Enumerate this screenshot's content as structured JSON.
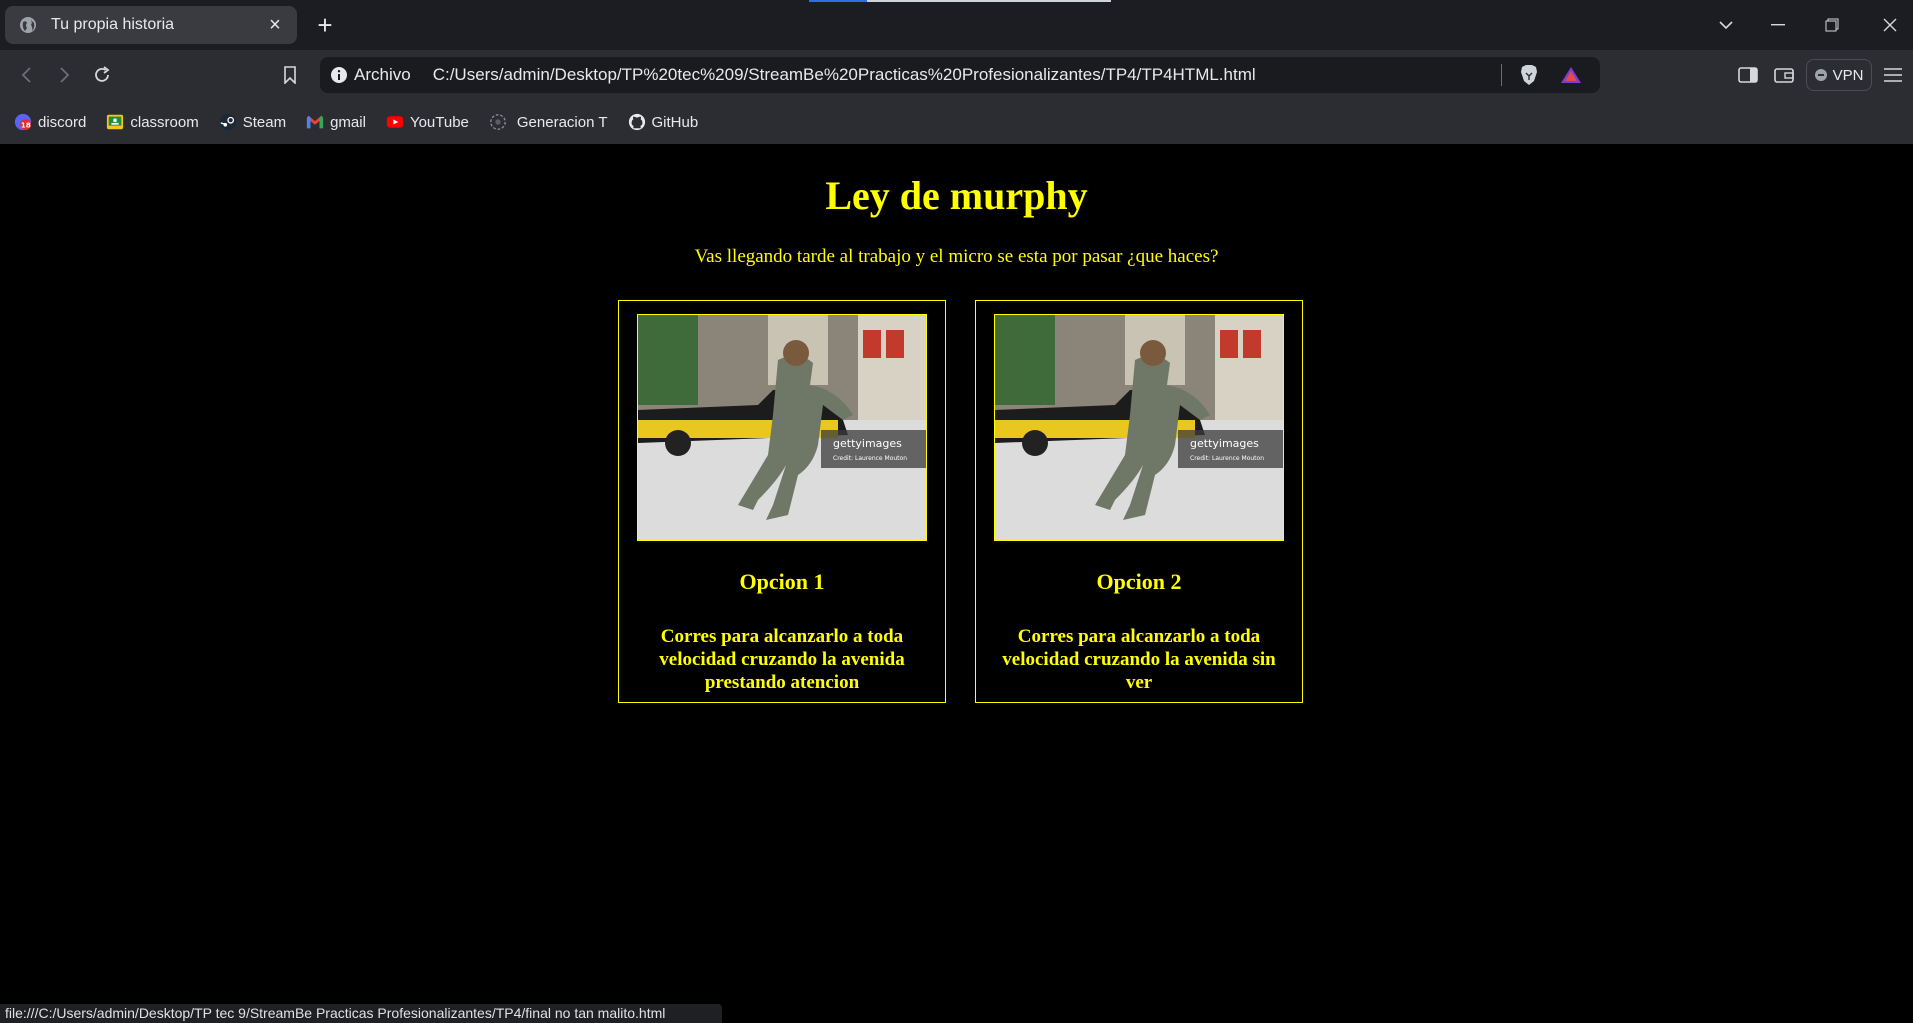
{
  "browser": {
    "tab": {
      "title": "Tu propia historia"
    },
    "address": {
      "scheme_label": "Archivo",
      "url": "C:/Users/admin/Desktop/TP%20tec%209/StreamBe%20Practicas%20Profesionalizantes/TP4/TP4HTML.html"
    },
    "vpn_label": "VPN",
    "bookmarks": [
      {
        "label": "discord",
        "icon": "discord-icon",
        "badge": "18"
      },
      {
        "label": "classroom",
        "icon": "classroom-icon"
      },
      {
        "label": "Steam",
        "icon": "steam-icon"
      },
      {
        "label": "gmail",
        "icon": "gmail-icon"
      },
      {
        "label": "YouTube",
        "icon": "youtube-icon"
      },
      {
        "label": "Generacion T",
        "icon": "generacion-t-icon"
      },
      {
        "label": "GitHub",
        "icon": "github-icon"
      }
    ],
    "status_url": "file:///C:/Users/admin/Desktop/TP tec 9/StreamBe Practicas Profesionalizantes/TP4/final no tan malito.html"
  },
  "page": {
    "title": "Ley de murphy",
    "prompt": "Vas llegando tarde al trabajo y el micro se esta por pasar ¿que haces?",
    "options": [
      {
        "label": "Opcion 1",
        "description": "Corres para alcanzarlo a toda velocidad cruzando la avenida prestando atencion",
        "photo_watermark": "gettyimages",
        "photo_credit": "Credit: Laurence Mouton"
      },
      {
        "label": "Opcion 2",
        "description": "Corres para alcanzarlo a toda velocidad cruzando la avenida sin ver",
        "photo_watermark": "gettyimages",
        "photo_credit": "Credit: Laurence Mouton"
      }
    ]
  },
  "colors": {
    "page_background": "#000000",
    "page_text": "#ffff00",
    "browser_chrome": "#2b2d33",
    "tab_strip": "#1b1d22"
  }
}
